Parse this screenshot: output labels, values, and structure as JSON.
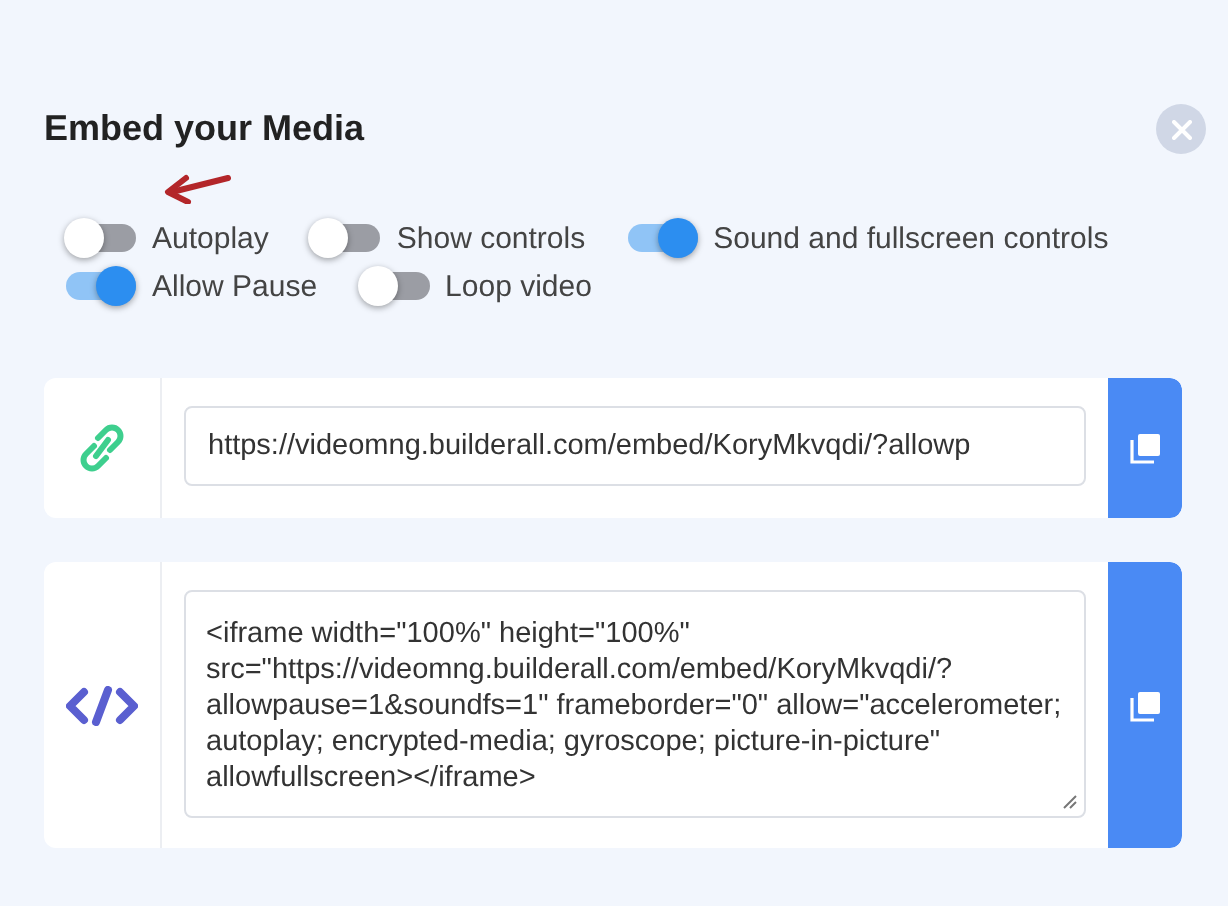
{
  "title": "Embed your Media",
  "toggles": [
    {
      "label": "Autoplay",
      "on": false
    },
    {
      "label": "Show controls",
      "on": false
    },
    {
      "label": "Sound and fullscreen controls",
      "on": true
    },
    {
      "label": "Allow Pause",
      "on": true
    },
    {
      "label": "Loop video",
      "on": false
    }
  ],
  "link": {
    "value": "https://videomng.builderall.com/embed/KoryMkvqdi/?allowp"
  },
  "embed_code": {
    "value": "<iframe width=\"100%\" height=\"100%\" src=\"https://videomng.builderall.com/embed/KoryMkvqdi/?allowpause=1&soundfs=1\" frameborder=\"0\" allow=\"accelerometer; autoplay; encrypted-media; gyroscope; picture-in-picture\" allowfullscreen></iframe>"
  }
}
